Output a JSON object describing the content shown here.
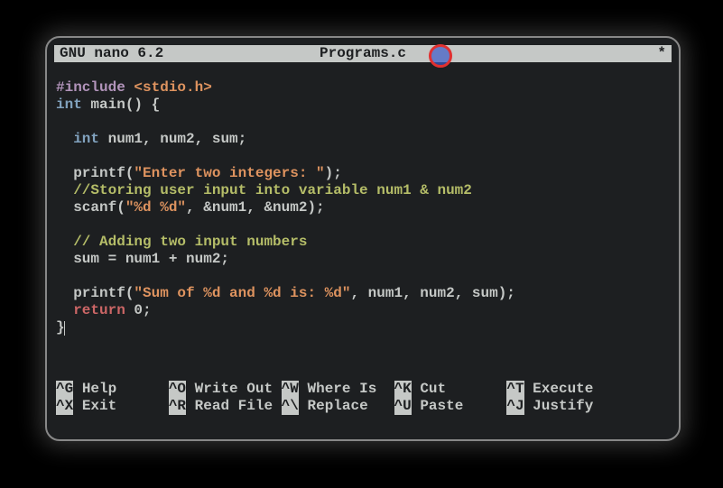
{
  "title": {
    "left": "  GNU nano 6.2",
    "center": "Programs.c",
    "right": "*"
  },
  "code": {
    "l1a": "#include",
    "l1b": " <stdio.h>",
    "l2a": "int",
    "l2b": " main() {",
    "l3a": "  ",
    "l3b": "int",
    "l3c": " num1, num2, sum;",
    "l4a": "  printf(",
    "l4b": "\"Enter two integers: \"",
    "l4c": ");",
    "l5a": "  ",
    "l5b": "//Storing user input into variable num1 & num2",
    "l6a": "  scanf(",
    "l6b": "\"%d %d\"",
    "l6c": ", &num1, &num2);",
    "l7a": "  ",
    "l7b": "// Adding two input numbers",
    "l8a": "  sum = num1 + num2;",
    "l9a": "  printf(",
    "l9b": "\"Sum of %d and %d is: %d\"",
    "l9c": ", num1, num2, sum);",
    "l10a": "  ",
    "l10b": "return",
    "l10c": " 0;",
    "l11a": "}"
  },
  "shortcuts": [
    {
      "key": "^G",
      "label": "Help"
    },
    {
      "key": "^O",
      "label": "Write Out"
    },
    {
      "key": "^W",
      "label": "Where Is"
    },
    {
      "key": "^K",
      "label": "Cut"
    },
    {
      "key": "^T",
      "label": "Execute"
    },
    {
      "key": "^X",
      "label": "Exit"
    },
    {
      "key": "^R",
      "label": "Read File"
    },
    {
      "key": "^\\",
      "label": "Replace"
    },
    {
      "key": "^U",
      "label": "Paste"
    },
    {
      "key": "^J",
      "label": "Justify"
    }
  ]
}
